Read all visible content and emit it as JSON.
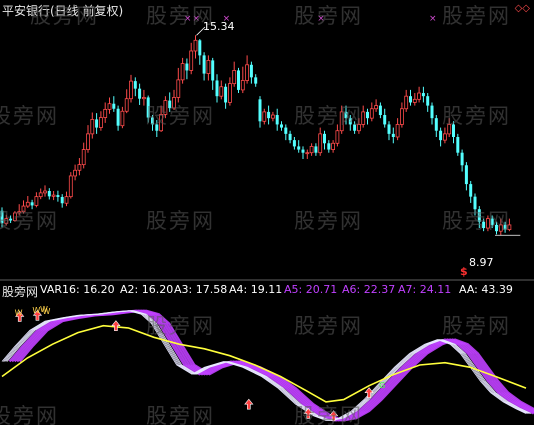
{
  "title": "平安银行(日线 前复权)",
  "watermark": "股旁网",
  "colors": {
    "up": "#ff4b4b",
    "down": "#54ffff",
    "ma": "#ffff3c",
    "fan": "#c040ff",
    "fan_light": "#e8e8ff",
    "marker": "#d24bd2",
    "label": "#ffffff"
  },
  "chart_data": [
    {
      "type": "candlestick",
      "price_range": [
        7.8,
        16.4
      ],
      "high_label": "15.34",
      "low_label": "8.97",
      "signal_label": "$",
      "candles": [
        [
          9.75,
          9.35,
          9.86,
          9.22
        ],
        [
          9.35,
          9.5,
          9.62,
          9.28
        ],
        [
          9.5,
          9.44,
          9.6,
          9.36
        ],
        [
          9.44,
          9.68,
          9.74,
          9.4
        ],
        [
          9.68,
          9.72,
          9.96,
          9.6
        ],
        [
          9.72,
          9.9,
          10.08,
          9.66
        ],
        [
          9.9,
          10.02,
          10.22,
          9.84
        ],
        [
          10.02,
          9.92,
          10.1,
          9.8
        ],
        [
          9.92,
          10.2,
          10.34,
          9.86
        ],
        [
          10.2,
          10.32,
          10.46,
          10.12
        ],
        [
          10.32,
          10.38,
          10.56,
          10.2
        ],
        [
          10.38,
          10.21,
          10.47,
          10.11
        ],
        [
          10.21,
          10.25,
          10.38,
          10.09
        ],
        [
          10.25,
          10.19,
          10.39,
          10.04
        ],
        [
          10.19,
          9.99,
          10.28,
          9.85
        ],
        [
          9.99,
          10.2,
          10.36,
          9.9
        ],
        [
          10.2,
          10.86,
          10.98,
          10.14
        ],
        [
          10.86,
          11.04,
          11.22,
          10.72
        ],
        [
          11.04,
          11.22,
          11.43,
          10.88
        ],
        [
          11.22,
          11.7,
          11.92,
          11.1
        ],
        [
          11.7,
          12.2,
          12.48,
          11.6
        ],
        [
          12.2,
          12.66,
          12.88,
          12.05
        ],
        [
          12.66,
          12.4,
          12.86,
          12.2
        ],
        [
          12.4,
          12.72,
          12.92,
          12.3
        ],
        [
          12.72,
          12.98,
          13.2,
          12.55
        ],
        [
          12.98,
          13.16,
          13.36,
          12.84
        ],
        [
          13.16,
          13.0,
          13.4,
          12.9
        ],
        [
          13.0,
          12.46,
          13.1,
          12.3
        ],
        [
          12.46,
          12.92,
          13.06,
          12.38
        ],
        [
          12.92,
          13.32,
          13.62,
          12.86
        ],
        [
          13.32,
          13.88,
          14.08,
          13.2
        ],
        [
          13.88,
          13.64,
          14.0,
          13.4
        ],
        [
          13.64,
          13.32,
          13.8,
          13.12
        ],
        [
          13.32,
          13.36,
          13.6,
          13.1
        ],
        [
          13.36,
          12.72,
          13.42,
          12.56
        ],
        [
          12.72,
          12.5,
          12.8,
          12.3
        ],
        [
          12.5,
          12.3,
          12.64,
          12.1
        ],
        [
          12.3,
          12.82,
          13.1,
          12.26
        ],
        [
          12.82,
          13.26,
          13.4,
          12.7
        ],
        [
          13.26,
          13.02,
          13.52,
          12.9
        ],
        [
          13.02,
          13.36,
          13.6,
          12.96
        ],
        [
          13.36,
          13.92,
          14.3,
          13.2
        ],
        [
          13.92,
          14.44,
          14.62,
          13.8
        ],
        [
          14.44,
          14.22,
          14.6,
          13.94
        ],
        [
          14.22,
          14.84,
          15.1,
          14.1
        ],
        [
          14.84,
          15.18,
          15.34,
          14.6
        ],
        [
          15.18,
          14.7,
          15.22,
          14.4
        ],
        [
          14.7,
          14.12,
          14.8,
          13.9
        ],
        [
          14.12,
          14.54,
          14.7,
          13.9
        ],
        [
          14.54,
          13.9,
          14.62,
          13.6
        ],
        [
          13.9,
          13.4,
          14.1,
          13.2
        ],
        [
          13.4,
          13.7,
          13.9,
          13.3
        ],
        [
          13.7,
          13.2,
          13.8,
          13.0
        ],
        [
          13.2,
          13.8,
          14.0,
          13.1
        ],
        [
          13.8,
          14.22,
          14.5,
          13.7
        ],
        [
          14.22,
          13.6,
          14.3,
          13.5
        ],
        [
          13.6,
          13.9,
          14.34,
          13.5
        ],
        [
          13.9,
          14.4,
          14.7,
          13.8
        ],
        [
          14.4,
          14.0,
          14.5,
          13.8
        ],
        [
          14.0,
          13.8,
          14.1,
          13.7
        ],
        [
          13.3,
          12.6,
          13.4,
          12.4
        ],
        [
          12.6,
          12.9,
          13.0,
          12.5
        ],
        [
          12.9,
          12.7,
          13.1,
          12.5
        ],
        [
          12.7,
          12.8,
          12.9,
          12.6
        ],
        [
          12.8,
          12.5,
          13.0,
          12.3
        ],
        [
          12.5,
          12.4,
          12.6,
          12.3
        ],
        [
          12.4,
          12.2,
          12.5,
          12.0
        ],
        [
          12.2,
          12.0,
          12.3,
          11.9
        ],
        [
          12.0,
          11.8,
          12.1,
          11.7
        ],
        [
          11.8,
          11.7,
          12.0,
          11.6
        ],
        [
          11.7,
          11.6,
          11.8,
          11.4
        ],
        [
          11.6,
          11.6,
          11.7,
          11.4
        ],
        [
          11.6,
          11.8,
          11.9,
          11.5
        ],
        [
          11.8,
          11.6,
          11.9,
          11.5
        ],
        [
          11.6,
          12.2,
          12.4,
          11.5
        ],
        [
          12.2,
          11.9,
          12.3,
          11.7
        ],
        [
          11.9,
          11.7,
          12.0,
          11.6
        ],
        [
          11.7,
          11.9,
          12.0,
          11.6
        ],
        [
          11.9,
          12.3,
          12.5,
          11.8
        ],
        [
          12.3,
          12.9,
          13.1,
          12.2
        ],
        [
          12.9,
          12.7,
          13.1,
          12.5
        ],
        [
          12.7,
          12.5,
          12.8,
          12.3
        ],
        [
          12.5,
          12.3,
          12.6,
          12.2
        ],
        [
          12.3,
          12.5,
          12.7,
          12.2
        ],
        [
          12.5,
          12.9,
          13.1,
          12.4
        ],
        [
          12.9,
          12.7,
          13.0,
          12.5
        ],
        [
          12.7,
          13.0,
          13.2,
          12.6
        ],
        [
          13.0,
          13.1,
          13.3,
          12.9
        ],
        [
          13.1,
          12.8,
          13.2,
          12.7
        ],
        [
          12.8,
          12.5,
          13.0,
          12.4
        ],
        [
          12.5,
          12.2,
          12.6,
          12.0
        ],
        [
          12.2,
          12.1,
          12.4,
          11.9
        ],
        [
          12.1,
          12.5,
          12.7,
          12.0
        ],
        [
          12.5,
          13.0,
          13.2,
          12.4
        ],
        [
          13.0,
          13.4,
          13.6,
          12.9
        ],
        [
          13.4,
          13.2,
          13.6,
          13.1
        ],
        [
          13.2,
          13.3,
          13.5,
          13.1
        ],
        [
          13.3,
          13.5,
          13.7,
          13.2
        ],
        [
          13.5,
          13.4,
          13.7,
          13.2
        ],
        [
          13.4,
          13.1,
          13.5,
          12.9
        ],
        [
          13.1,
          12.7,
          13.2,
          12.5
        ],
        [
          12.7,
          12.3,
          12.8,
          12.1
        ],
        [
          12.3,
          12.0,
          12.4,
          11.8
        ],
        [
          12.0,
          12.2,
          12.4,
          11.9
        ],
        [
          12.2,
          12.5,
          12.7,
          12.1
        ],
        [
          12.5,
          12.1,
          12.6,
          11.9
        ],
        [
          12.1,
          11.6,
          12.2,
          11.5
        ],
        [
          11.6,
          11.2,
          11.7,
          11.0
        ],
        [
          11.2,
          10.6,
          11.3,
          10.4
        ],
        [
          10.6,
          10.2,
          10.7,
          10.0
        ],
        [
          10.2,
          9.8,
          10.3,
          9.6
        ],
        [
          9.8,
          9.4,
          9.9,
          9.2
        ],
        [
          9.4,
          9.2,
          9.5,
          9.1
        ],
        [
          9.2,
          9.5,
          9.6,
          9.1
        ],
        [
          9.5,
          9.3,
          9.6,
          9.2
        ],
        [
          9.3,
          9.1,
          9.4,
          9.0
        ],
        [
          9.1,
          9.3,
          9.5,
          8.97
        ],
        [
          9.3,
          9.15,
          9.4,
          9.05
        ],
        [
          9.15,
          9.3,
          9.5,
          9.1
        ]
      ],
      "top_markers": [
        43,
        45,
        52,
        74,
        100,
        130
      ]
    },
    {
      "type": "line",
      "indicator_legend": [
        {
          "label": "VAR16: 16.20",
          "color": "#ffffff"
        },
        {
          "label": "A2: 16.20",
          "color": "#ffffff"
        },
        {
          "label": "A3: 17.58",
          "color": "#ffffff"
        },
        {
          "label": "A4: 19.11",
          "color": "#ffffff"
        },
        {
          "label": "A5: 20.71",
          "color": "#c040ff"
        },
        {
          "label": "A6: 22.37",
          "color": "#c040ff"
        },
        {
          "label": "A7: 24.11",
          "color": "#c040ff"
        },
        {
          "label": "AA: 43.39",
          "color": "#ffffff"
        }
      ],
      "ylim": [
        0,
        110
      ],
      "osc_points": [
        [
          0,
          55
        ],
        [
          10,
          68
        ],
        [
          22,
          82
        ],
        [
          34,
          90
        ],
        [
          48,
          93
        ],
        [
          60,
          95
        ],
        [
          74,
          96
        ],
        [
          88,
          98
        ],
        [
          100,
          99
        ],
        [
          110,
          96
        ],
        [
          118,
          88
        ],
        [
          128,
          70
        ],
        [
          138,
          52
        ],
        [
          150,
          44
        ],
        [
          160,
          50
        ],
        [
          175,
          55
        ],
        [
          190,
          50
        ],
        [
          205,
          42
        ],
        [
          218,
          32
        ],
        [
          232,
          18
        ],
        [
          246,
          8
        ],
        [
          256,
          4
        ],
        [
          266,
          6
        ],
        [
          276,
          12
        ],
        [
          286,
          22
        ],
        [
          298,
          36
        ],
        [
          310,
          50
        ],
        [
          322,
          62
        ],
        [
          334,
          70
        ],
        [
          344,
          74
        ],
        [
          354,
          70
        ],
        [
          362,
          62
        ],
        [
          370,
          50
        ],
        [
          378,
          38
        ],
        [
          386,
          28
        ],
        [
          396,
          20
        ],
        [
          406,
          14
        ],
        [
          414,
          10
        ]
      ],
      "ma_points": [
        [
          0,
          42
        ],
        [
          20,
          58
        ],
        [
          40,
          70
        ],
        [
          60,
          80
        ],
        [
          80,
          86
        ],
        [
          100,
          84
        ],
        [
          120,
          76
        ],
        [
          140,
          70
        ],
        [
          160,
          66
        ],
        [
          180,
          60
        ],
        [
          200,
          52
        ],
        [
          220,
          42
        ],
        [
          240,
          30
        ],
        [
          256,
          20
        ],
        [
          270,
          22
        ],
        [
          290,
          34
        ],
        [
          310,
          44
        ],
        [
          330,
          52
        ],
        [
          350,
          54
        ],
        [
          370,
          50
        ],
        [
          390,
          42
        ],
        [
          414,
          32
        ]
      ],
      "buy_arrows": [
        [
          14,
          94
        ],
        [
          28,
          95
        ],
        [
          90,
          86
        ],
        [
          195,
          18
        ],
        [
          242,
          10
        ],
        [
          262,
          8
        ],
        [
          290,
          28
        ]
      ],
      "tags": [
        [
          10,
          95,
          "W"
        ],
        [
          24,
          97,
          "W"
        ],
        [
          30,
          98,
          "W"
        ],
        [
          32,
          96,
          "W"
        ],
        [
          298,
          32,
          "G"
        ]
      ]
    }
  ]
}
